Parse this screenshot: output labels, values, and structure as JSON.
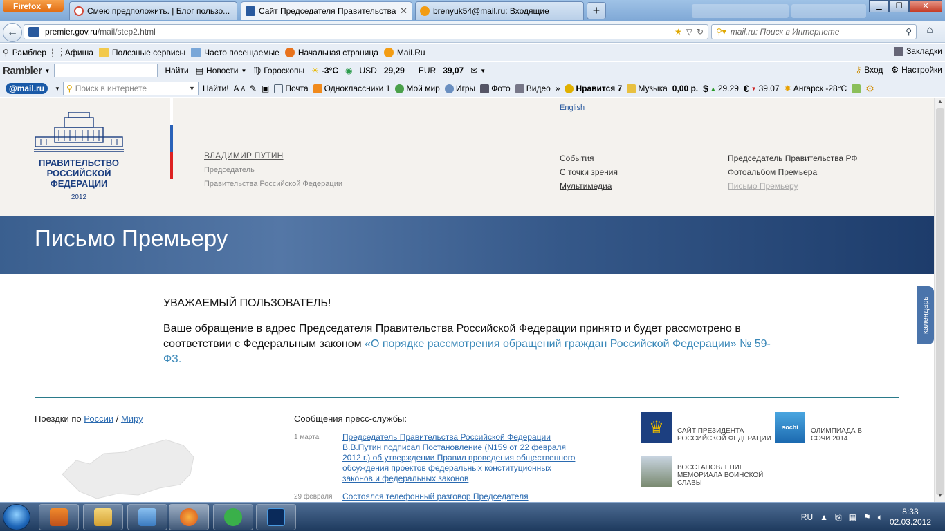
{
  "browser": {
    "app_button": "Firefox",
    "tabs": [
      {
        "label": "Смею предположить. | Блог пользо...",
        "fav": "#d24a3a"
      },
      {
        "label": "Сайт Председателя Правительства ...",
        "fav": "#2a5a9e"
      },
      {
        "label": "brenyuk54@mail.ru: Входящие",
        "fav": "#f39c12"
      }
    ],
    "new_tab": "+",
    "url_domain": "premier.gov.ru",
    "url_path": "/mail/step2.html",
    "search_placeholder": "mail.ru: Поиск в Интернете"
  },
  "bookmarks": {
    "items": [
      "Рамблер",
      "Афиша",
      "Полезные сервисы",
      "Часто посещаемые",
      "Начальная страница",
      "Mail.Ru"
    ],
    "right": "Закладки"
  },
  "rambler": {
    "logo": "Rambler",
    "find": "Найти",
    "news": "Новости",
    "horo": "Гороскопы",
    "temp": "-3°C",
    "usd_label": "USD",
    "usd": "29,29",
    "eur_label": "EUR",
    "eur": "39,07",
    "login": "Вход",
    "settings": "Настройки"
  },
  "mailbar": {
    "logo": "@mail.ru",
    "search_placeholder": "Поиск в интернете",
    "find": "Найти!",
    "mail": "Почта",
    "ok": "Одноклассники 1",
    "myworld": "Мой мир",
    "games": "Игры",
    "photo": "Фото",
    "video": "Видео",
    "more": "»",
    "likes": "Нравится 7",
    "music": "Музыка",
    "balance": "0,00 р.",
    "usd": "29.29",
    "eur": "39.07",
    "weather": "Ангарск -28°C"
  },
  "site": {
    "logo_text": "ПРАВИТЕЛЬСТВО РОССИЙСКОЙ ФЕДЕРАЦИИ",
    "logo_year": "2012",
    "pm_name": "ВЛАДИМИР ПУТИН",
    "pm_title1": "Председатель",
    "pm_title2": "Правительства Российской Федерации",
    "english": "English",
    "nav_col1": [
      "События",
      "С точки зрения",
      "Мультимедиа"
    ],
    "nav_col2": [
      "Председатель Правительства РФ",
      "Фотоальбом Премьера",
      "Письмо Премьеру"
    ],
    "banner_title": "Письмо Премьеру",
    "msg_heading": "УВАЖАЕМЫЙ ПОЛЬЗОВАТЕЛЬ!",
    "msg_text": "Ваше обращение в адрес Председателя Правительства Российской Федерации принято и будет рассмотрено в соответствии с Федеральным законом ",
    "msg_link": "«О порядке рассмотрения обращений граждан Российской Федерации» № 59-ФЗ.",
    "trips_label": "Поездки по ",
    "trips_russia": "России",
    "trips_sep": " / ",
    "trips_world": "Миру",
    "press_title": "Сообщения пресс-службы:",
    "news": [
      {
        "date": "1 марта",
        "text": "Председатель Правительства Российской Федерации В.В.Путин подписал Постановление (N159 от 22 февраля 2012 г.) об утверждении Правил проведения общественного обсуждения проектов федеральных конституционных законов и федеральных законов"
      },
      {
        "date": "29 февраля",
        "text": "Состоялся телефонный разговор Председателя"
      }
    ],
    "links": [
      "САЙТ ПРЕЗИДЕНТА РОССИЙСКОЙ ФЕДЕРАЦИИ",
      "ОЛИМПИАДА В СОЧИ 2014",
      "ВОССТАНОВЛЕНИЕ МЕМОРИАЛА ВОИНСКОЙ СЛАВЫ"
    ],
    "calendar": "календарь"
  },
  "taskbar": {
    "lang": "RU",
    "time": "8:33",
    "date": "02.03.2012"
  },
  "colors": {
    "banner": "#3a5f8f",
    "link": "#2a6ab0",
    "header_bg": "#f4f2ee",
    "gov_blue": "#1c3f80"
  }
}
